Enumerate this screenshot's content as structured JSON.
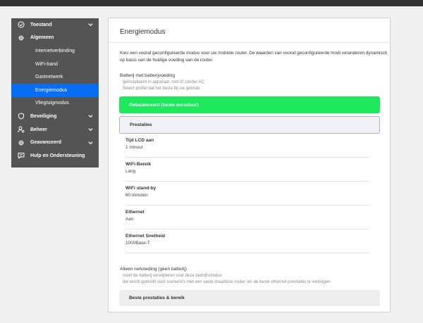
{
  "sidebar": {
    "items": [
      {
        "label": "Toestand",
        "icon": "check-circle-icon",
        "chevron": true
      },
      {
        "label": "Algemeen",
        "icon": "gear-icon",
        "chevron": false
      },
      {
        "label": "Beveiliging",
        "icon": "shield-icon",
        "chevron": true
      },
      {
        "label": "Beheer",
        "icon": "user-gear-icon",
        "chevron": true
      },
      {
        "label": "Geavanceerd",
        "icon": "gear-icon",
        "chevron": true
      },
      {
        "label": "Hulp en Ondersteuning",
        "icon": "chat-icon",
        "chevron": false
      }
    ],
    "subitems": [
      {
        "label": "Internetverbinding"
      },
      {
        "label": "WiFi-band"
      },
      {
        "label": "Gastnetwerk"
      },
      {
        "label": "Energiemodus",
        "active": true
      },
      {
        "label": "Vliegtuigmodus"
      }
    ]
  },
  "panel": {
    "title": "Energiemodus",
    "intro": "Kies een vooraf geconfigureerde modus voor uw mobiele router. De waarden van vooraf geconfigureerde modi veranderen dynamisch op basis van de huidige voeding van de router.",
    "battery_section": {
      "title": "Batterij met batterijvoeding",
      "sub1": "geïnstalleerd in apparaat, met of zonder AC",
      "sub2": "Select profiel dat het beste bij uw gebruik"
    },
    "profiles": {
      "selected": "Gebalanceerd (beste accuduur)",
      "other": "Prestaties"
    },
    "details": [
      {
        "label": "Tijd LCD aan",
        "value": "1 minuut"
      },
      {
        "label": "WiFi-Bereik",
        "value": "Lang"
      },
      {
        "label": "WiFi stand-by",
        "value": "60 minuten"
      },
      {
        "label": "Ethernet",
        "value": "Aan"
      },
      {
        "label": "Ethernet Snelheid",
        "value": "1000Base-T"
      }
    ],
    "ac_section": {
      "title": "Alleen netvoeding (geen batterij)",
      "sub1": "moet de batterij verwijderen voor deze bedrijfsmodus",
      "sub2": "die wordt gebruikt voor scenario's met een vaste draadloze router om de beste ethernet-prestaties te verkrijgen",
      "button": "Beste prestaties & bereik"
    }
  },
  "colors": {
    "sidebar_bg": "#545454",
    "active": "#0a6ef4",
    "green": "#1ee85b"
  }
}
